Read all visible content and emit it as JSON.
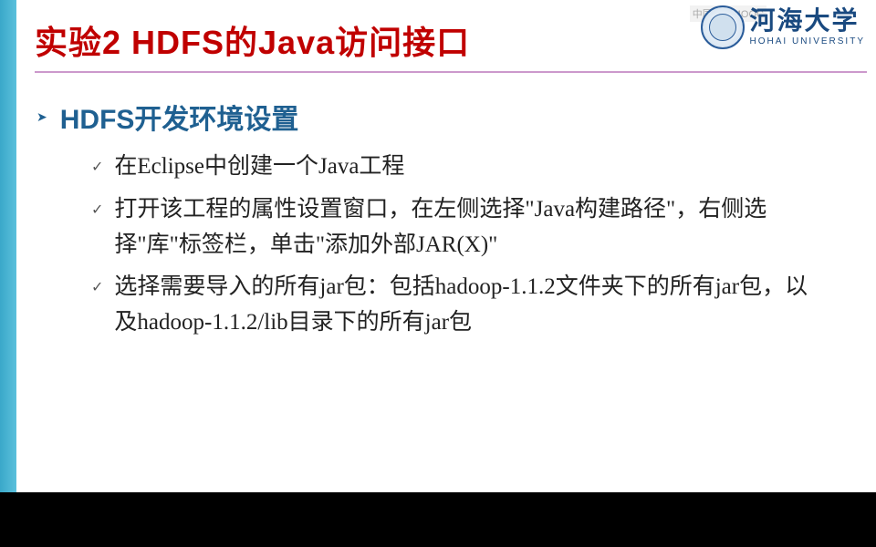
{
  "slide": {
    "title": "实验2 HDFS的Java访问接口",
    "section_heading": "HDFS开发环境设置",
    "bullets": [
      "在Eclipse中创建一个Java工程",
      "打开该工程的属性设置窗口，在左侧选择\"Java构建路径\"，右侧选择\"库\"标签栏，单击\"添加外部JAR(X)\"",
      "选择需要导入的所有jar包：包括hadoop-1.1.2文件夹下的所有jar包，以及hadoop-1.1.2/lib目录下的所有jar包"
    ]
  },
  "logo": {
    "zh": "河海大学",
    "en": "HOHAI UNIVERSITY"
  },
  "watermark": "中国大学MOOC"
}
